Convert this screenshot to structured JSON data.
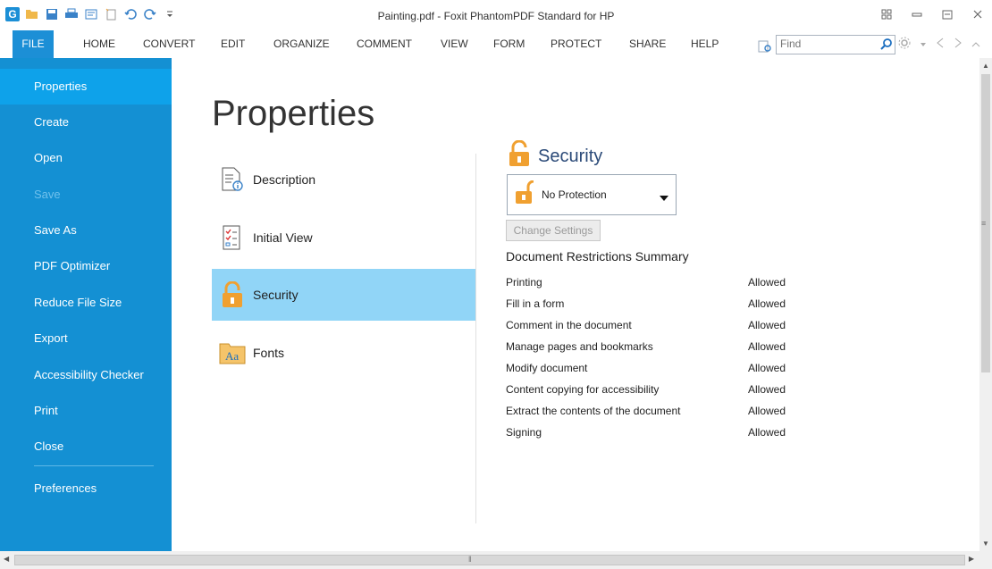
{
  "window": {
    "title": "Painting.pdf - Foxit PhantomPDF Standard for HP"
  },
  "quick_access": [
    {
      "icon": "app-logo-icon",
      "glyph": "G"
    },
    {
      "icon": "open-folder-icon"
    },
    {
      "icon": "save-icon"
    },
    {
      "icon": "print-icon"
    },
    {
      "icon": "properties-icon"
    },
    {
      "icon": "new-page-icon"
    },
    {
      "icon": "undo-icon"
    },
    {
      "icon": "redo-icon"
    },
    {
      "icon": "customize-dropdown-icon"
    }
  ],
  "menu": {
    "items": [
      {
        "label": "FILE"
      },
      {
        "label": "HOME"
      },
      {
        "label": "CONVERT"
      },
      {
        "label": "EDIT"
      },
      {
        "label": "ORGANIZE"
      },
      {
        "label": "COMMENT"
      },
      {
        "label": "VIEW"
      },
      {
        "label": "FORM"
      },
      {
        "label": "PROTECT"
      },
      {
        "label": "SHARE"
      },
      {
        "label": "HELP"
      }
    ],
    "find_placeholder": "Find"
  },
  "sidebar": {
    "items": [
      {
        "label": "Properties",
        "active": true
      },
      {
        "label": "Create"
      },
      {
        "label": "Open"
      },
      {
        "label": "Save",
        "disabled": true
      },
      {
        "label": "Save As"
      },
      {
        "label": "PDF Optimizer"
      },
      {
        "label": "Reduce File Size"
      },
      {
        "label": "Export"
      },
      {
        "label": "Accessibility Checker"
      },
      {
        "label": "Print"
      },
      {
        "label": "Close"
      },
      {
        "label": "Preferences"
      }
    ]
  },
  "main": {
    "title": "Properties",
    "nav": [
      {
        "label": "Description",
        "icon": "description-icon"
      },
      {
        "label": "Initial View",
        "icon": "initial-view-icon"
      },
      {
        "label": "Security",
        "icon": "lock-icon",
        "active": true
      },
      {
        "label": "Fonts",
        "icon": "fonts-folder-icon"
      }
    ],
    "security": {
      "heading": "Security",
      "dropdown_value": "No Protection",
      "change_button": "Change Settings",
      "summary_title": "Document Restrictions Summary",
      "restrictions": [
        {
          "name": "Printing",
          "status": "Allowed"
        },
        {
          "name": "Fill in a form",
          "status": "Allowed"
        },
        {
          "name": "Comment in the document",
          "status": "Allowed"
        },
        {
          "name": "Manage pages and bookmarks",
          "status": "Allowed"
        },
        {
          "name": "Modify document",
          "status": "Allowed"
        },
        {
          "name": "Content copying for accessibility",
          "status": "Allowed"
        },
        {
          "name": "Extract the contents of the document",
          "status": "Allowed"
        },
        {
          "name": "Signing",
          "status": "Allowed"
        }
      ]
    }
  },
  "colors": {
    "accent": "#1490d3",
    "active_sidebar": "#0ea2ea",
    "active_nav": "#91d5f7",
    "lock": "#f0a030",
    "heading": "#2b4a78"
  }
}
